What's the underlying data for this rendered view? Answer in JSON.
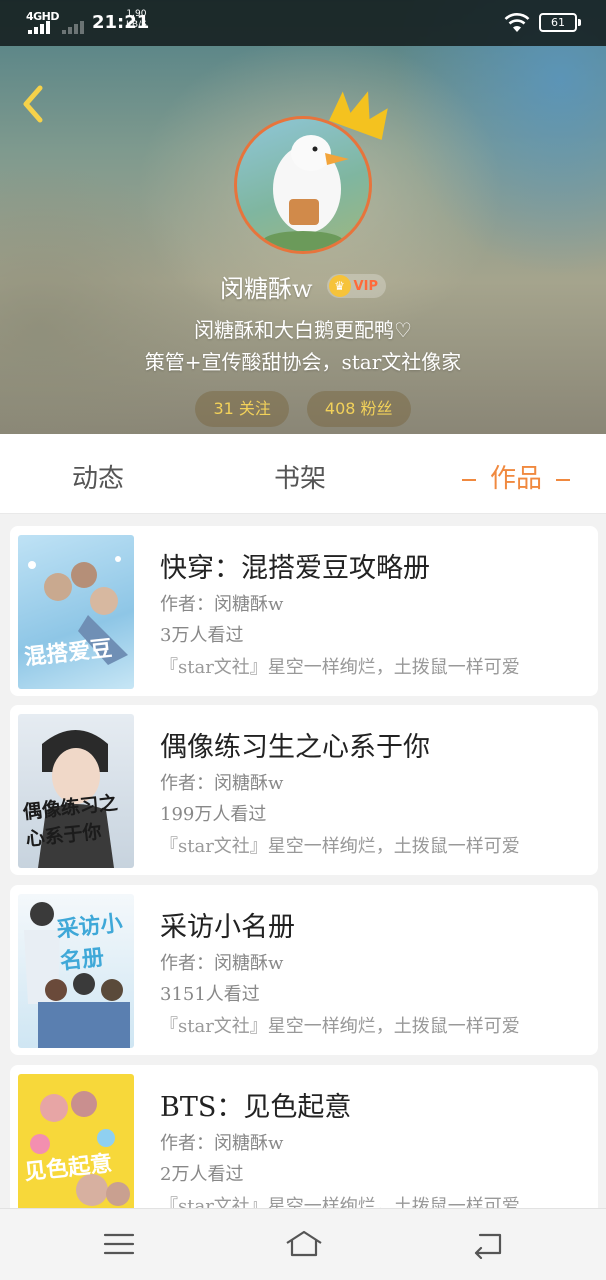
{
  "status_bar": {
    "network": "4GHD",
    "time": "21:21",
    "speed_value": "1.90",
    "speed_unit": "KB/S",
    "battery": "61"
  },
  "profile": {
    "username": "闵糖酥w",
    "vip_label": "VIP",
    "bio_line1": "闵糖酥和大白鹅更配鸭♡",
    "bio_line2": "策管+宣传酸甜协会，star文社像家",
    "following": "31 关注",
    "followers": "408 粉丝"
  },
  "tabs": [
    {
      "label": "动态",
      "active": false
    },
    {
      "label": "书架",
      "active": false
    },
    {
      "label": "作品",
      "active": true
    }
  ],
  "books": [
    {
      "title": "快穿：混搭爱豆攻略册",
      "author": "作者：闵糖酥w",
      "views": "3万人看过",
      "desc": "『star文社』星空一样绚烂，土拨鼠一样可爱",
      "cover_text": "混搭爱豆",
      "cover_color": "#9fd0ea"
    },
    {
      "title": "偶像练习生之心系于你",
      "author": "作者：闵糖酥w",
      "views": "199万人看过",
      "desc": "『star文社』星空一样绚烂，土拨鼠一样可爱",
      "cover_text": "偶像练习之心系于你",
      "cover_color": "#d9e2ea"
    },
    {
      "title": "采访小名册",
      "author": "作者：闵糖酥w",
      "views": "3151人看过",
      "desc": "『star文社』星空一样绚烂，土拨鼠一样可爱",
      "cover_text": "采访小名册",
      "cover_color": "#cfe6f3"
    },
    {
      "title": "BTS：见色起意",
      "author": "作者：闵糖酥w",
      "views": "2万人看过",
      "desc": "『star文社』星空一样绚烂，土拨鼠一样可爱",
      "cover_text": "见色起意",
      "cover_color": "#f7d83a"
    }
  ],
  "icons": {
    "back": "chevron-left-icon",
    "menu": "menu-icon",
    "home": "home-icon",
    "return": "return-icon"
  },
  "colors": {
    "accent": "#f0893f",
    "stat_text": "#f2d15a",
    "avatar_border": "#e7743c"
  }
}
